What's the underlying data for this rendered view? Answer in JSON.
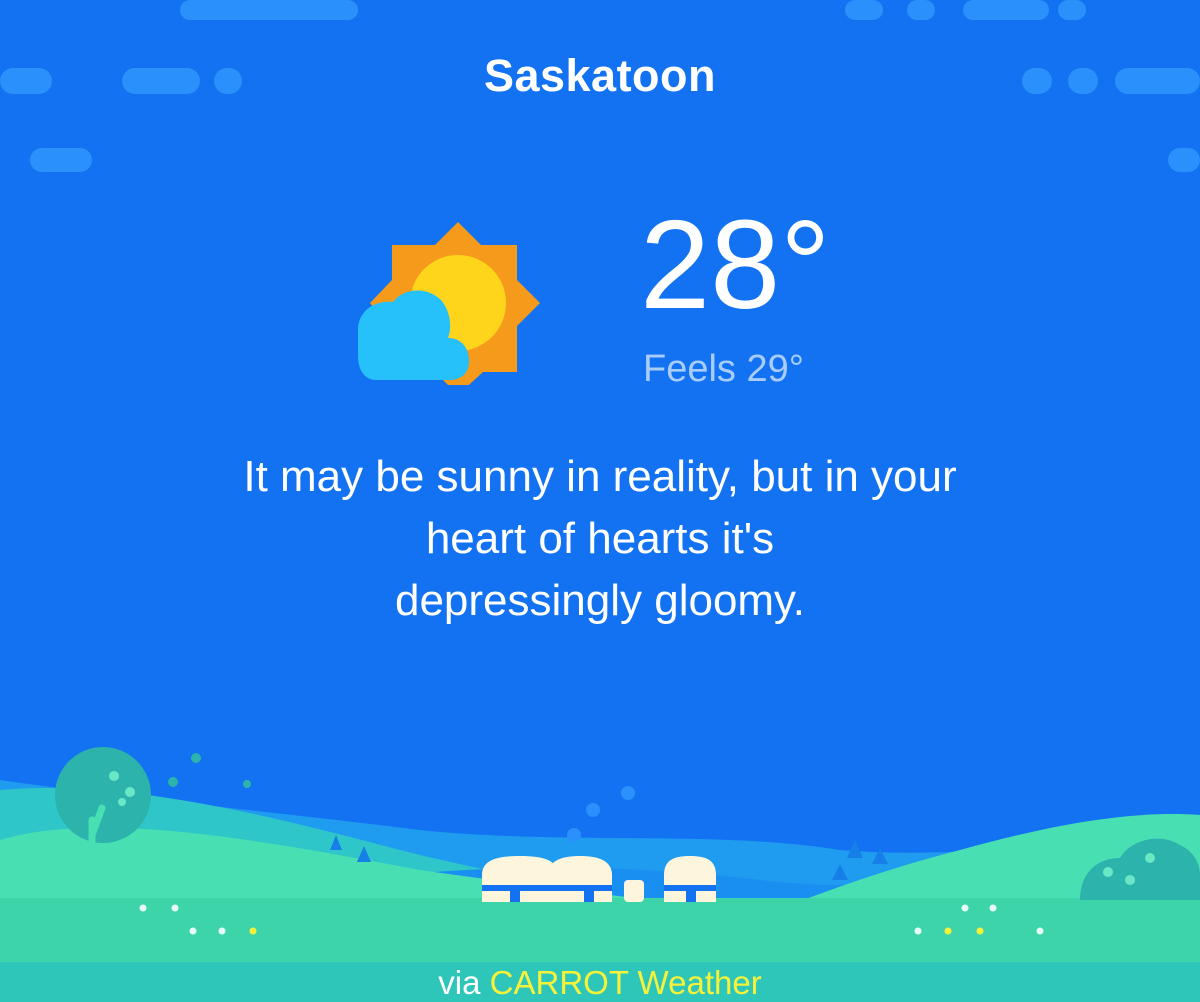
{
  "location": {
    "city": "Saskatoon"
  },
  "current": {
    "temperature": "28°",
    "feels_like": "Feels 29°",
    "condition_icon": "partly-sunny-icon"
  },
  "commentary": {
    "line1": "It may be sunny in reality, but in your",
    "line2": "heart of hearts it's",
    "line3": "depressingly gloomy."
  },
  "footer": {
    "prefix": "via",
    "brand": "CARROT Weather"
  },
  "colors": {
    "background": "#1272f2",
    "sun_rays": "#f59a1a",
    "sun_core": "#ffd51c",
    "cloud": "#26c0fb",
    "hill_front": "#48dfb3",
    "footer_bar": "#2ec6b9",
    "brand_text": "#f6f23a"
  }
}
